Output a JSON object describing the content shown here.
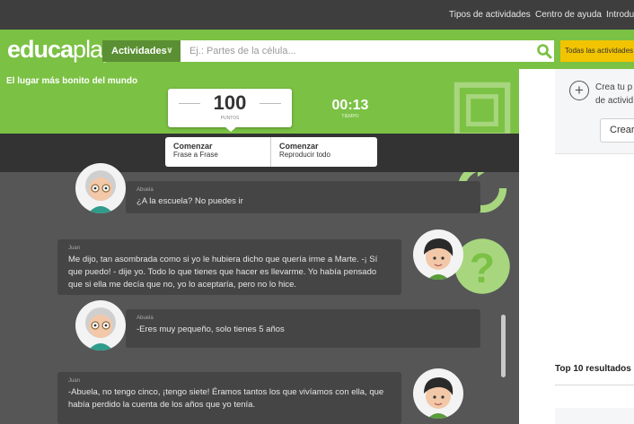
{
  "topnav": {
    "links": [
      "Tipos de actividades",
      "Centro de ayuda",
      "Introduc"
    ]
  },
  "header": {
    "logo_bold": "educa",
    "logo_light": "play",
    "activities_label": "Actividades",
    "search_placeholder": "Ej.: Partes de la célula...",
    "all_activities_label": "Todas las actividades"
  },
  "game": {
    "title": "El lugar más bonito del mundo",
    "score_value": "100",
    "score_label": "PUNTOS",
    "timer_value": "00:13",
    "timer_label": "TIEMPO",
    "modes": [
      {
        "title": "Comenzar",
        "subtitle": "Frase a Frase"
      },
      {
        "title": "Comenzar",
        "subtitle": "Reproducir todo"
      }
    ]
  },
  "chat": {
    "messages": [
      {
        "speaker": "Abuela",
        "text": "¿A la escuela? No puedes ir"
      },
      {
        "speaker": "Juan",
        "text": "Me dijo, tan asombrada como si yo le hubiera dicho que quería irme a Marte. -¡ Sí que puedo! - dije yo. Todo lo que tienes que hacer es llevarme. Yo había pensado que si ella me decía que no, yo lo aceptaría, pero no lo hice."
      },
      {
        "speaker": "Abuela",
        "text": "-Eres muy pequeño, solo tienes 5 años"
      },
      {
        "speaker": "Juan",
        "text": "-Abuela, no tengo cinco, ¡tengo siete! Éramos tantos los que vivíamos con ella, que había perdido la cuenta de los años que yo tenía."
      }
    ]
  },
  "sidebar": {
    "create_text_line1": "Crea tu p",
    "create_text_line2": "de activid",
    "create_button": "Crear",
    "top10_title": "Top 10 resultados"
  },
  "colors": {
    "brand_green": "#7bc144",
    "dark_green": "#5b8f33",
    "yellow": "#f2c400",
    "topnav_bg": "#3e3e3e",
    "chat_bg": "#565656"
  }
}
